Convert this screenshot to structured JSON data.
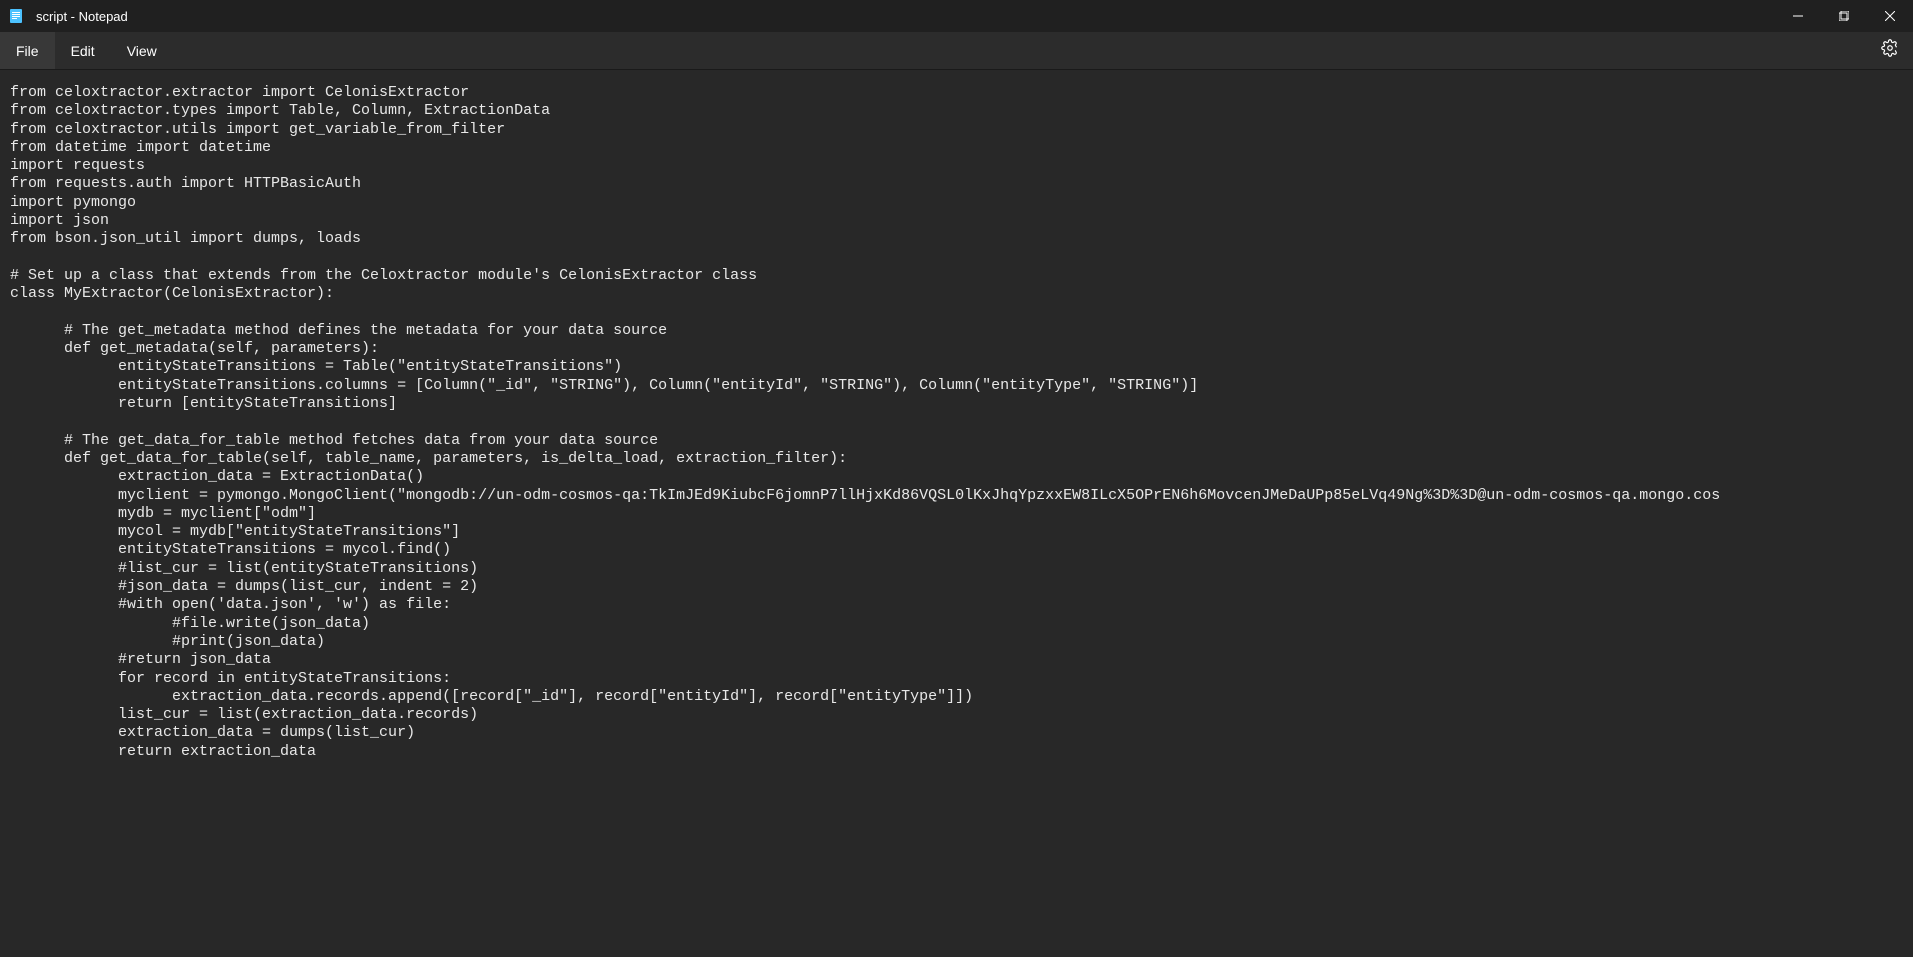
{
  "window": {
    "title": "script - Notepad"
  },
  "menubar": {
    "file": "File",
    "edit": "Edit",
    "view": "View"
  },
  "editor": {
    "content": "from celoxtractor.extractor import CelonisExtractor\nfrom celoxtractor.types import Table, Column, ExtractionData\nfrom celoxtractor.utils import get_variable_from_filter\nfrom datetime import datetime\nimport requests\nfrom requests.auth import HTTPBasicAuth\nimport pymongo\nimport json\nfrom bson.json_util import dumps, loads\n\n# Set up a class that extends from the Celoxtractor module's CelonisExtractor class\nclass MyExtractor(CelonisExtractor):\n\n      # The get_metadata method defines the metadata for your data source\n      def get_metadata(self, parameters):\n            entityStateTransitions = Table(\"entityStateTransitions\")\n            entityStateTransitions.columns = [Column(\"_id\", \"STRING\"), Column(\"entityId\", \"STRING\"), Column(\"entityType\", \"STRING\")]\n            return [entityStateTransitions]\n\n      # The get_data_for_table method fetches data from your data source\n      def get_data_for_table(self, table_name, parameters, is_delta_load, extraction_filter):\n            extraction_data = ExtractionData()\n            myclient = pymongo.MongoClient(\"mongodb://un-odm-cosmos-qa:TkImJEd9KiubcF6jomnP7llHjxKd86VQSL0lKxJhqYpzxxEW8ILcX5OPrEN6h6MovcenJMeDaUPp85eLVq49Ng%3D%3D@un-odm-cosmos-qa.mongo.cos\n            mydb = myclient[\"odm\"]\n            mycol = mydb[\"entityStateTransitions\"]\n            entityStateTransitions = mycol.find()\n            #list_cur = list(entityStateTransitions)\n            #json_data = dumps(list_cur, indent = 2)\n            #with open('data.json', 'w') as file:\n                  #file.write(json_data)\n                  #print(json_data)\n            #return json_data\n            for record in entityStateTransitions:\n                  extraction_data.records.append([record[\"_id\"], record[\"entityId\"], record[\"entityType\"]])\n            list_cur = list(extraction_data.records)\n            extraction_data = dumps(list_cur)\n            return extraction_data"
  }
}
